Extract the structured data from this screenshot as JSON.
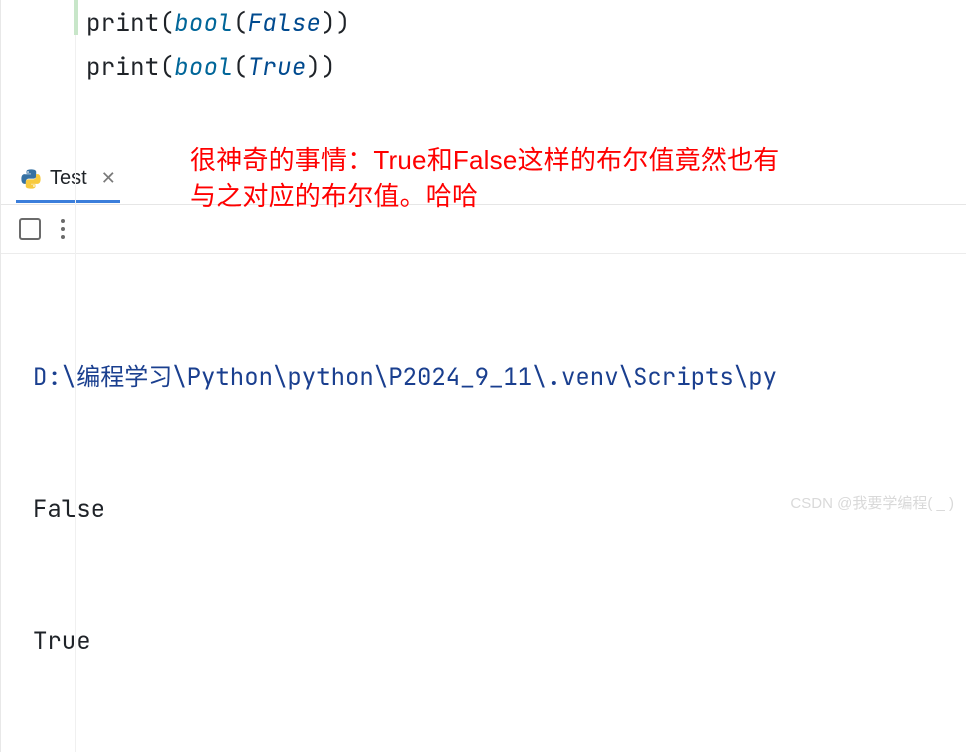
{
  "code": {
    "line1_fn": "print",
    "line1_builtin": "bool",
    "line1_const": "False",
    "line2_fn": "print",
    "line2_builtin": "bool",
    "line2_const": "True"
  },
  "annotation": {
    "line1": "很神奇的事情：True和False这样的布尔值竟然也有",
    "line2": "与之对应的布尔值。哈哈"
  },
  "tab": {
    "label": "Test",
    "icon": "python-icon"
  },
  "console": {
    "path": "D:\\编程学习\\Python\\python\\P2024_9_11\\.venv\\Scripts\\py",
    "out1": "False",
    "out2": "True"
  },
  "watermark": "CSDN @我要学编程( _ )"
}
